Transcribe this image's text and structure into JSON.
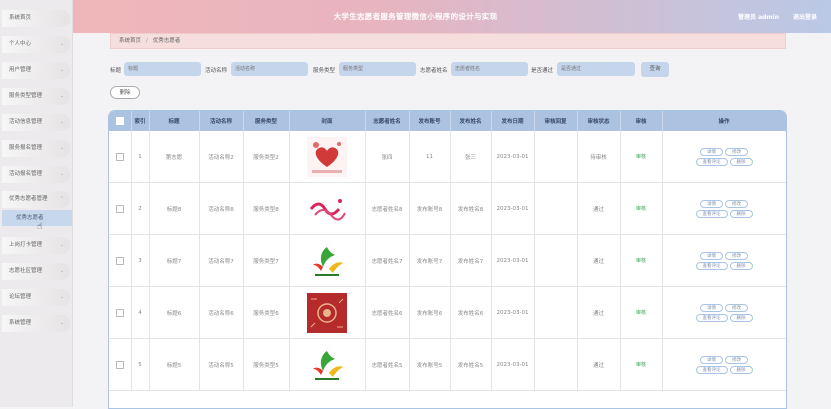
{
  "header": {
    "title": "大学生志愿者服务管理微信小程序的设计与实现",
    "user": "管理员 admin",
    "logout": "退出登录"
  },
  "sidebar": {
    "items": [
      {
        "label": "系统首页"
      },
      {
        "label": "个人中心"
      },
      {
        "label": "用户管理"
      },
      {
        "label": "服务类型管理"
      },
      {
        "label": "活动信息管理"
      },
      {
        "label": "服务报名管理"
      },
      {
        "label": "活动报名管理"
      },
      {
        "label": "优秀志愿者管理"
      }
    ],
    "active_sub": "优秀志愿者",
    "items_after": [
      {
        "label": "上岗打卡管理"
      },
      {
        "label": "志愿社区管理"
      },
      {
        "label": "论坛管理"
      },
      {
        "label": "系统管理"
      }
    ]
  },
  "breadcrumb": {
    "home": "系统首页",
    "separator": "/",
    "current": "优秀志愿者"
  },
  "search": {
    "title_label": "标题",
    "title_placeholder": "标题",
    "activity_label": "活动名称",
    "activity_placeholder": "活动名称",
    "type_label": "服务类型",
    "type_placeholder": "服务类型",
    "volunteer_label": "志愿者姓名",
    "volunteer_placeholder": "志愿者姓名",
    "approved_label": "是否通过",
    "approved_placeholder": "是否通过",
    "search_button": "查询"
  },
  "actions": {
    "delete_button": "删除"
  },
  "table": {
    "columns": [
      "",
      "索引",
      "标题",
      "活动名称",
      "服务类型",
      "封面",
      "志愿者姓名",
      "发布账号",
      "发布姓名",
      "发布日期",
      "审核回复",
      "审核状态",
      "审核",
      "操作"
    ],
    "buttons": {
      "detail": "详情",
      "edit": "修改",
      "comment": "查看评论",
      "delete": "删除"
    },
    "rows": [
      {
        "index": "1",
        "title": "第志愿",
        "activity": "活动名称2",
        "type": "服务类型2",
        "cover": "cover-hearts",
        "volunteer": "张四",
        "account": "11",
        "publisher": "张三",
        "date": "2023-03-01",
        "reply": "",
        "status": "待审核",
        "audit": "审核"
      },
      {
        "index": "2",
        "title": "标题8",
        "activity": "活动名称8",
        "type": "服务类型8",
        "cover": "cover-volunteer-text",
        "volunteer": "志愿者姓名8",
        "account": "发布账号8",
        "publisher": "发布姓名8",
        "date": "2023-03-01",
        "reply": "",
        "status": "通过",
        "audit": "审核"
      },
      {
        "index": "3",
        "title": "标题7",
        "activity": "活动名称7",
        "type": "服务类型7",
        "cover": "cover-green-logo",
        "volunteer": "志愿者姓名7",
        "account": "发布账号7",
        "publisher": "发布姓名7",
        "date": "2023-03-01",
        "reply": "",
        "status": "通过",
        "audit": "审核"
      },
      {
        "index": "4",
        "title": "标题6",
        "activity": "活动名称6",
        "type": "服务类型6",
        "cover": "cover-red-pattern",
        "volunteer": "志愿者姓名6",
        "account": "发布账号6",
        "publisher": "发布姓名6",
        "date": "2023-03-01",
        "reply": "",
        "status": "通过",
        "audit": "审核"
      },
      {
        "index": "5",
        "title": "标题5",
        "activity": "活动名称5",
        "type": "服务类型5",
        "cover": "cover-green-logo",
        "volunteer": "志愿者姓名5",
        "account": "发布账号5",
        "publisher": "发布姓名5",
        "date": "2023-03-01",
        "reply": "",
        "status": "通过",
        "audit": "审核"
      }
    ]
  }
}
